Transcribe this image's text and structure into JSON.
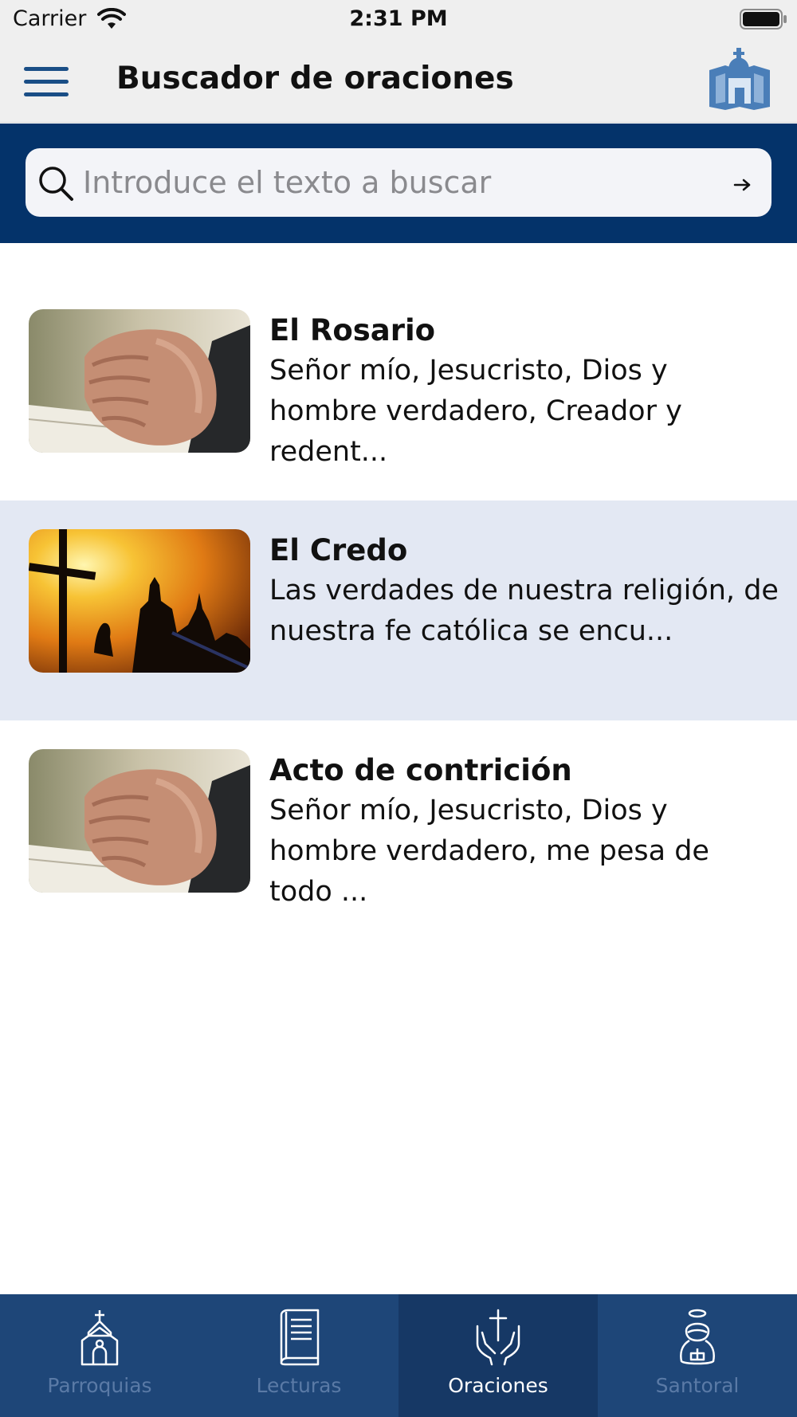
{
  "status_bar": {
    "carrier": "Carrier",
    "time": "2:31 PM",
    "wifi_icon": "wifi-icon",
    "battery_icon": "battery-icon"
  },
  "nav": {
    "title": "Buscador de oraciones",
    "menu_icon": "hamburger-menu-icon",
    "logo_icon": "church-logo-icon"
  },
  "search": {
    "placeholder": "Introduce el texto a buscar",
    "value": "",
    "icon": "magnifier-icon",
    "go_icon": "arrow-right-icon"
  },
  "prayers": [
    {
      "title": "El Rosario",
      "description": "Señor mío, Jesucristo, Dios y hombre verdadero, Creador y redent...",
      "image": "praying-hands-photo"
    },
    {
      "title": "El Credo",
      "description": "Las verdades de nuestra religión, de nuestra fe católica se encu...",
      "image": "cross-sunset-photo"
    },
    {
      "title": "Acto de contrición",
      "description": "Señor mío, Jesucristo, Dios y hombre verdadero, me pesa de todo ...",
      "image": "praying-hands-photo"
    }
  ],
  "selected_index": 1,
  "tabs": [
    {
      "label": "Parroquias",
      "icon": "church-icon",
      "active": false
    },
    {
      "label": "Lecturas",
      "icon": "book-icon",
      "active": false
    },
    {
      "label": "Oraciones",
      "icon": "praying-hands-cross-icon",
      "active": true
    },
    {
      "label": "Santoral",
      "icon": "saint-icon",
      "active": false
    }
  ],
  "colors": {
    "brand_navy": "#04336a",
    "tab_bar": "#1e4678",
    "tab_active": "#163865",
    "selected_row": "#e3e8f3",
    "menu_icon": "#1a4e86"
  }
}
